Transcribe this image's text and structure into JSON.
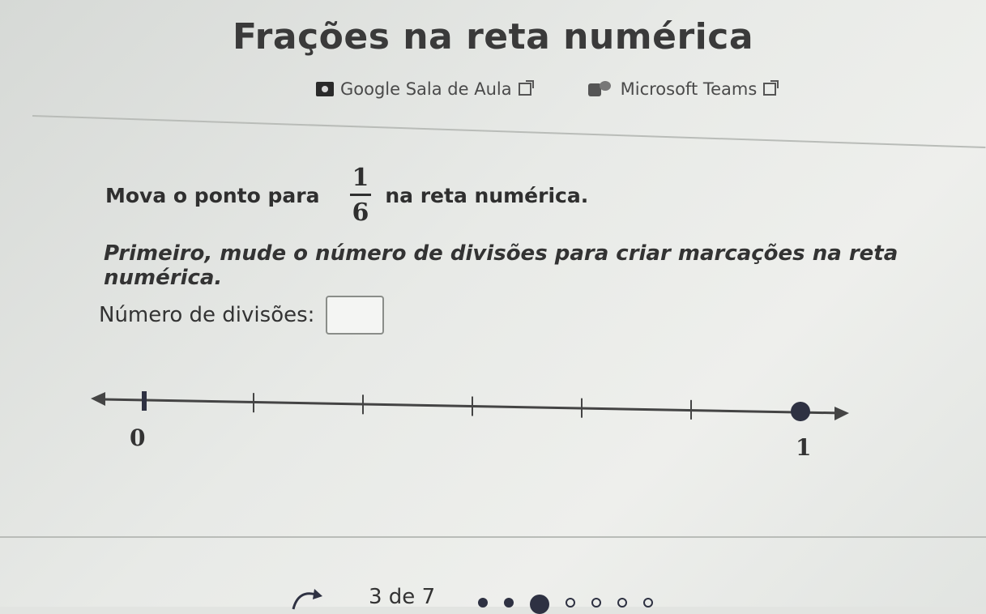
{
  "header": {
    "title": "Frações na reta numérica",
    "share": [
      {
        "label": "Google Sala de Aula",
        "icon": "google-classroom-icon"
      },
      {
        "label": "Microsoft Teams",
        "icon": "microsoft-teams-icon"
      }
    ]
  },
  "exercise": {
    "prompt_before": "Mova o ponto para",
    "fraction_numerator": "1",
    "fraction_denominator": "6",
    "prompt_after": "na reta numérica.",
    "hint": "Primeiro, mude o número de divisões para criar marcações na reta numérica.",
    "divisions_label": "Número de divisões:",
    "divisions_value": "",
    "divisions_placeholder": ""
  },
  "number_line": {
    "min_label": "0",
    "max_label": "1",
    "tick_count": 7,
    "point_value": 1
  },
  "progress": {
    "label": "3 de 7",
    "current": 3,
    "total": 7
  },
  "colors": {
    "text": "#333333",
    "point": "#2e3142",
    "line": "#444444"
  }
}
